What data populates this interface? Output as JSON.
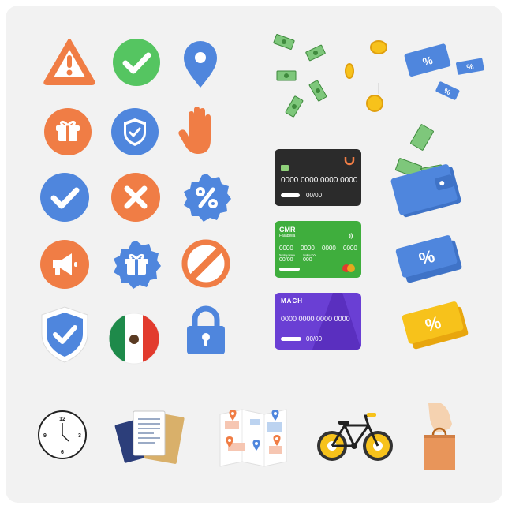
{
  "icons": {
    "warning": "warning-triangle",
    "check_green": "check-circle",
    "map_pin": "map-pin",
    "gift": "gift-box",
    "shield": "shield-check",
    "hand": "hand-stop",
    "check_blue": "check-circle",
    "close_orange": "close-circle",
    "percent_badge": "percent-badge",
    "megaphone": "megaphone",
    "gift_badge": "gift-badge",
    "forbidden": "forbidden-sign",
    "shield_large": "shield-check",
    "flag_mexico": "mexico-flag",
    "padlock": "padlock",
    "money_scatter": "money-bills-coins",
    "coupon_blue": "coupon-tickets",
    "wallet": "wallet-with-cash",
    "ticket_blue": "percent-ticket",
    "ticket_yellow": "percent-ticket",
    "clock": "wall-clock",
    "documents": "documents-folder",
    "map": "map-with-pins",
    "bicycle": "bicycle",
    "shopping_bag": "hand-holding-bag"
  },
  "cards": {
    "black": {
      "number": "0000 0000 0000 0000",
      "expiry": "00/00",
      "color": "#2b2b2b"
    },
    "green": {
      "brand": "CMR",
      "brand_sub": "Falabella",
      "number": [
        "0000",
        "0000",
        "0000",
        "0000"
      ],
      "label_name": "Nombre tarjeta",
      "label_code": "Código CVV",
      "expiry": "00/00",
      "code": "000",
      "color": "#3fae3d"
    },
    "purple": {
      "brand": "MACH",
      "number": "0000 0000 0000 0000",
      "expiry": "00/00",
      "color": "#6a3fd4"
    }
  },
  "clock": {
    "n12": "12",
    "n3": "3",
    "n6": "6",
    "n9": "9"
  },
  "colors": {
    "orange": "#f07d45",
    "green": "#55c561",
    "blue": "#4f86dd",
    "yellow": "#f7c21b",
    "money": "#7ec77b"
  }
}
